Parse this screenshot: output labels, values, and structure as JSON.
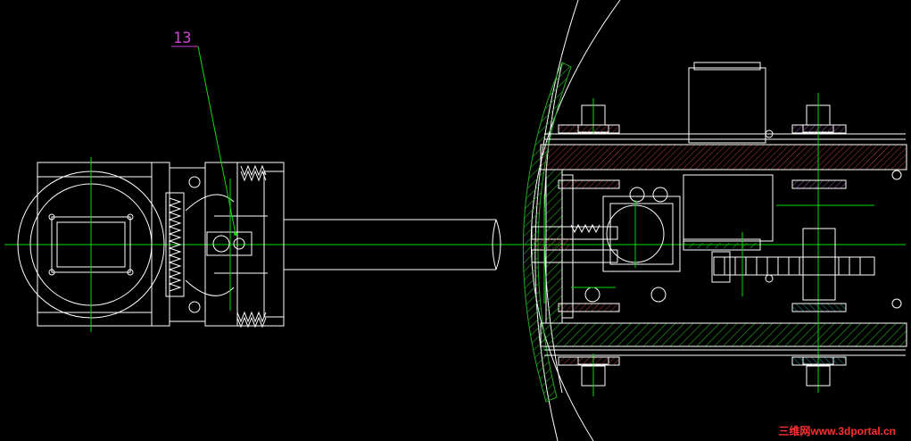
{
  "drawing": {
    "part_label": "13",
    "watermark": "三维网www.3dportal.cn"
  },
  "colors": {
    "background": "#000000",
    "line": "#ffffff",
    "center": "#00dd00",
    "hatch_green": "#22aa22",
    "hatch_red": "#b83a3a",
    "hatch_purple": "#a050b0",
    "hatch_teal": "#209090",
    "leader": "#cc44cc",
    "watermark": "#ff3030"
  }
}
